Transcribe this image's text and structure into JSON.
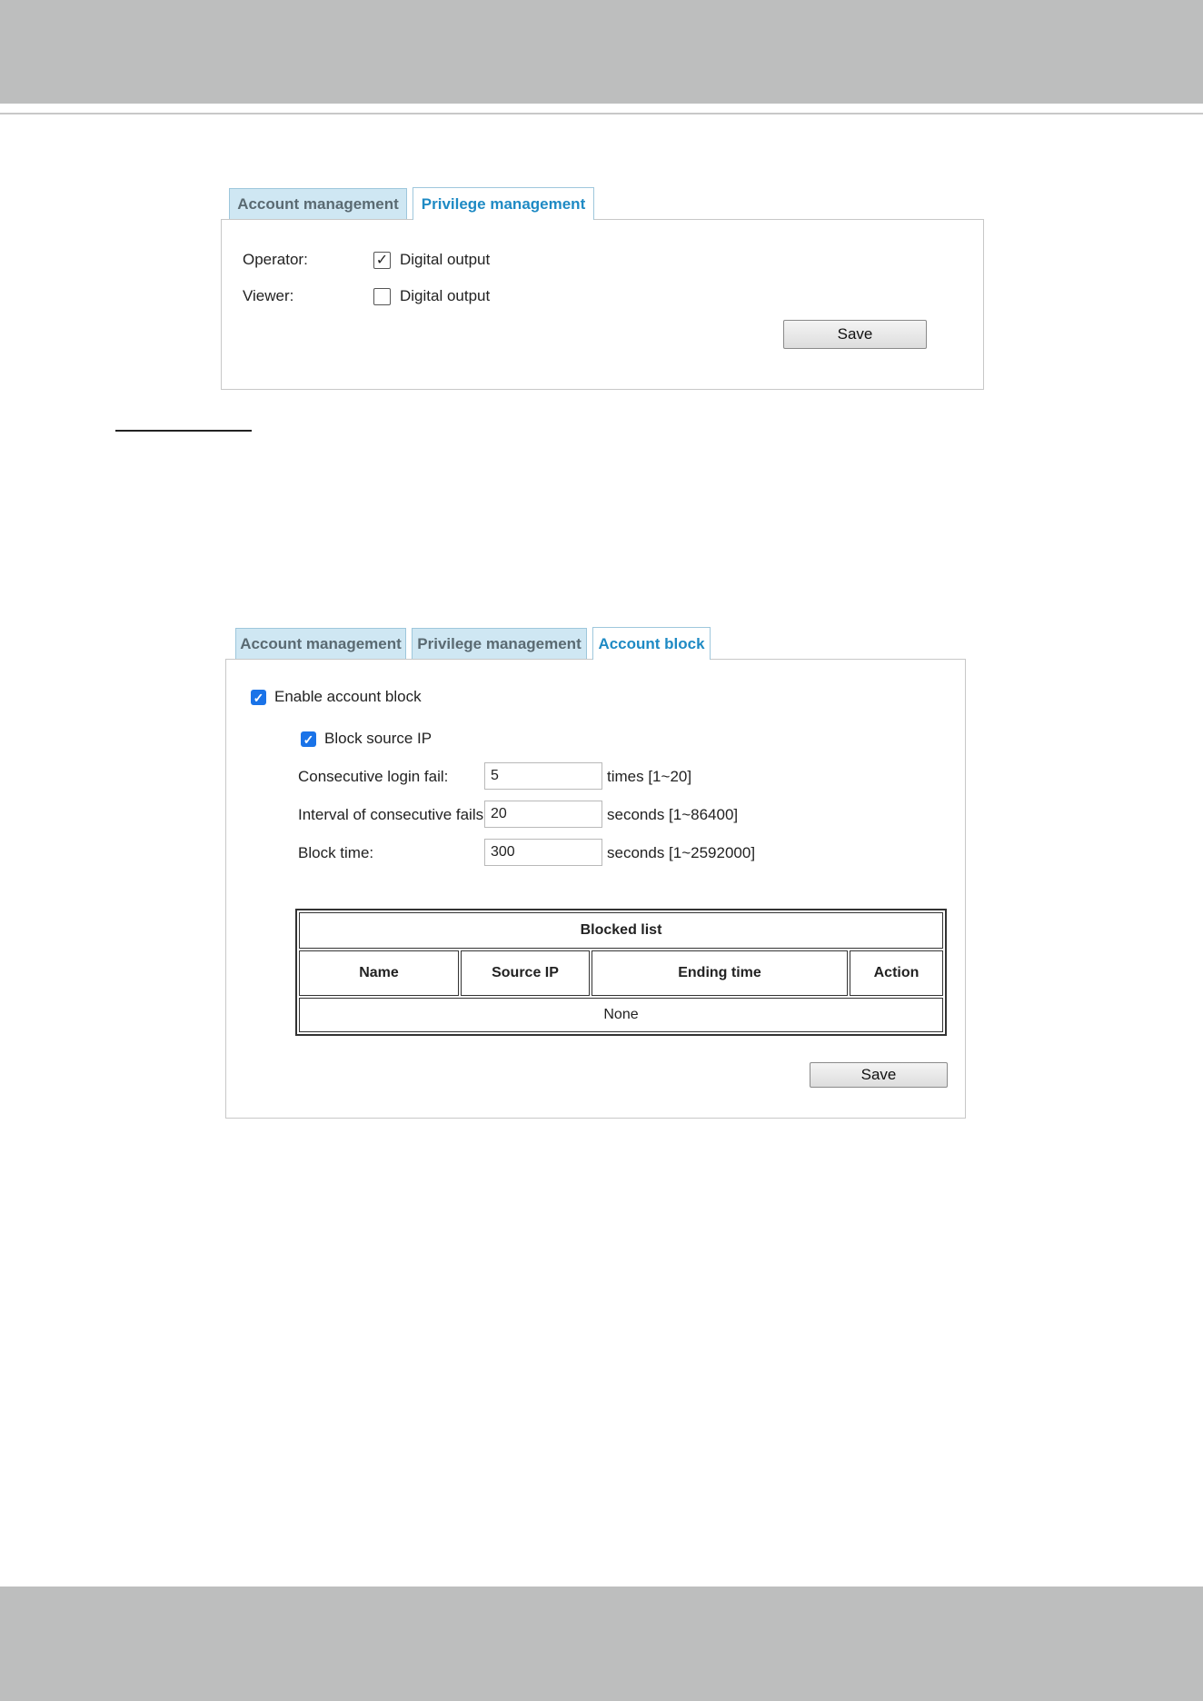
{
  "panel1": {
    "tabs": [
      {
        "label": "Account management",
        "active": false
      },
      {
        "label": "Privilege management",
        "active": true
      }
    ],
    "rows": [
      {
        "label": "Operator:",
        "option": "Digital output",
        "checked": true
      },
      {
        "label": "Viewer:",
        "option": "Digital output",
        "checked": false
      }
    ],
    "save_label": "Save"
  },
  "panel2": {
    "tabs": [
      {
        "label": "Account management",
        "active": false
      },
      {
        "label": "Privilege management",
        "active": false
      },
      {
        "label": "Account block",
        "active": true
      }
    ],
    "enable_account_block": {
      "label": "Enable account block",
      "checked": true
    },
    "block_source_ip": {
      "label": "Block source IP",
      "checked": true
    },
    "fields": [
      {
        "label": "Consecutive login fail:",
        "value": "5",
        "hint": "times [1~20]"
      },
      {
        "label": "Interval of consecutive fails:",
        "value": "20",
        "hint": "seconds [1~86400]"
      },
      {
        "label": "Block time:",
        "value": "300",
        "hint": "seconds [1~2592000]"
      }
    ],
    "blocked_list": {
      "title": "Blocked list",
      "columns": [
        "Name",
        "Source IP",
        "Ending time",
        "Action"
      ],
      "empty_text": "None"
    },
    "save_label": "Save"
  },
  "colors": {
    "tab_inactive_bg": "#cfe7f3",
    "tab_active_text": "#1e8ac4",
    "checkbox_accent": "#1a73e8",
    "header_band": "#bdbebe"
  }
}
